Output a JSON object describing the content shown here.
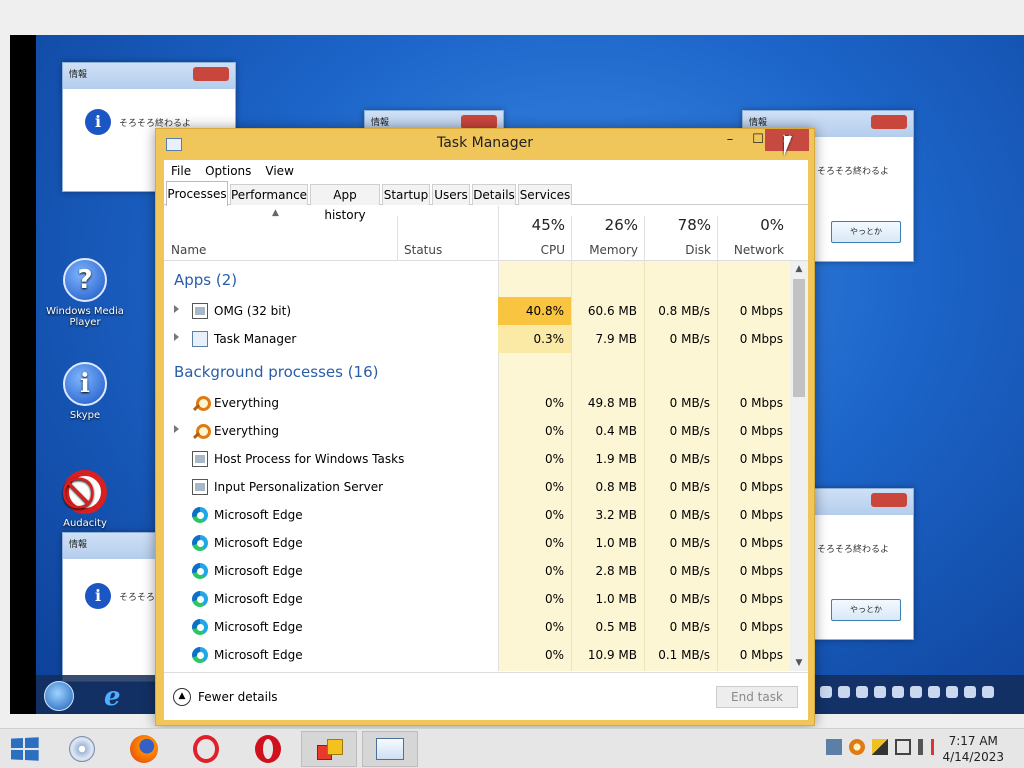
{
  "desktop": {
    "icons": [
      {
        "label": "Windows Media Player"
      },
      {
        "label": "Skype"
      },
      {
        "label": "Audacity"
      }
    ],
    "message_boxes": [
      {
        "title": "情報",
        "text": "そろそろ終わるよ",
        "button": "やっとか"
      }
    ]
  },
  "task_manager": {
    "title": "Task Manager",
    "window_buttons": {
      "minimize": "–",
      "maximize": "☐",
      "close": "✕"
    },
    "menu": [
      "File",
      "Options",
      "View"
    ],
    "tabs": [
      "Processes",
      "Performance",
      "App history",
      "Startup",
      "Users",
      "Details",
      "Services"
    ],
    "active_tab": "Processes",
    "columns": {
      "name": "Name",
      "status": "Status",
      "cpu": {
        "pct": "45%",
        "label": "CPU"
      },
      "memory": {
        "pct": "26%",
        "label": "Memory"
      },
      "disk": {
        "pct": "78%",
        "label": "Disk"
      },
      "network": {
        "pct": "0%",
        "label": "Network"
      }
    },
    "groups": [
      {
        "label": "Apps (2)",
        "processes": [
          {
            "name": "OMG (32 bit)",
            "icon": "window-icon",
            "expandable": true,
            "cpu": "40.8%",
            "memory": "60.6 MB",
            "disk": "0.8 MB/s",
            "network": "0 Mbps",
            "heat": "hot"
          },
          {
            "name": "Task Manager",
            "icon": "task-manager-icon",
            "expandable": true,
            "cpu": "0.3%",
            "memory": "7.9 MB",
            "disk": "0 MB/s",
            "network": "0 Mbps",
            "heat": "warm"
          }
        ]
      },
      {
        "label": "Background processes (16)",
        "processes": [
          {
            "name": "Everything",
            "icon": "search-icon",
            "expandable": false,
            "cpu": "0%",
            "memory": "49.8 MB",
            "disk": "0 MB/s",
            "network": "0 Mbps"
          },
          {
            "name": "Everything",
            "icon": "search-icon",
            "expandable": true,
            "cpu": "0%",
            "memory": "0.4 MB",
            "disk": "0 MB/s",
            "network": "0 Mbps"
          },
          {
            "name": "Host Process for Windows Tasks",
            "icon": "window-icon",
            "expandable": false,
            "cpu": "0%",
            "memory": "1.9 MB",
            "disk": "0 MB/s",
            "network": "0 Mbps"
          },
          {
            "name": "Input Personalization Server",
            "icon": "window-icon",
            "expandable": false,
            "cpu": "0%",
            "memory": "0.8 MB",
            "disk": "0 MB/s",
            "network": "0 Mbps"
          },
          {
            "name": "Microsoft Edge",
            "icon": "edge-icon",
            "expandable": false,
            "cpu": "0%",
            "memory": "3.2 MB",
            "disk": "0 MB/s",
            "network": "0 Mbps"
          },
          {
            "name": "Microsoft Edge",
            "icon": "edge-icon",
            "expandable": false,
            "cpu": "0%",
            "memory": "1.0 MB",
            "disk": "0 MB/s",
            "network": "0 Mbps"
          },
          {
            "name": "Microsoft Edge",
            "icon": "edge-icon",
            "expandable": false,
            "cpu": "0%",
            "memory": "2.8 MB",
            "disk": "0 MB/s",
            "network": "0 Mbps"
          },
          {
            "name": "Microsoft Edge",
            "icon": "edge-icon",
            "expandable": false,
            "cpu": "0%",
            "memory": "1.0 MB",
            "disk": "0 MB/s",
            "network": "0 Mbps"
          },
          {
            "name": "Microsoft Edge",
            "icon": "edge-icon",
            "expandable": false,
            "cpu": "0%",
            "memory": "0.5 MB",
            "disk": "0 MB/s",
            "network": "0 Mbps"
          },
          {
            "name": "Microsoft Edge",
            "icon": "edge-icon",
            "expandable": false,
            "cpu": "0%",
            "memory": "10.9 MB",
            "disk": "0.1 MB/s",
            "network": "0 Mbps"
          }
        ]
      }
    ],
    "footer": {
      "fewer_details": "Fewer details",
      "end_task": "End task"
    }
  },
  "host_taskbar": {
    "apps": [
      "disc-icon",
      "firefox-icon",
      "opera-outline-icon",
      "opera-icon",
      "tiles-icon",
      "task-manager-icon"
    ],
    "clock": {
      "time": "7:17 AM",
      "date": "4/14/2023"
    }
  },
  "colors": {
    "cpu_hot": "#f9c440",
    "cpu_warm": "#fbe9a6",
    "heat_bg": "#fdf6d4",
    "group_text": "#2a5da8",
    "close_button": "#c64a40"
  }
}
